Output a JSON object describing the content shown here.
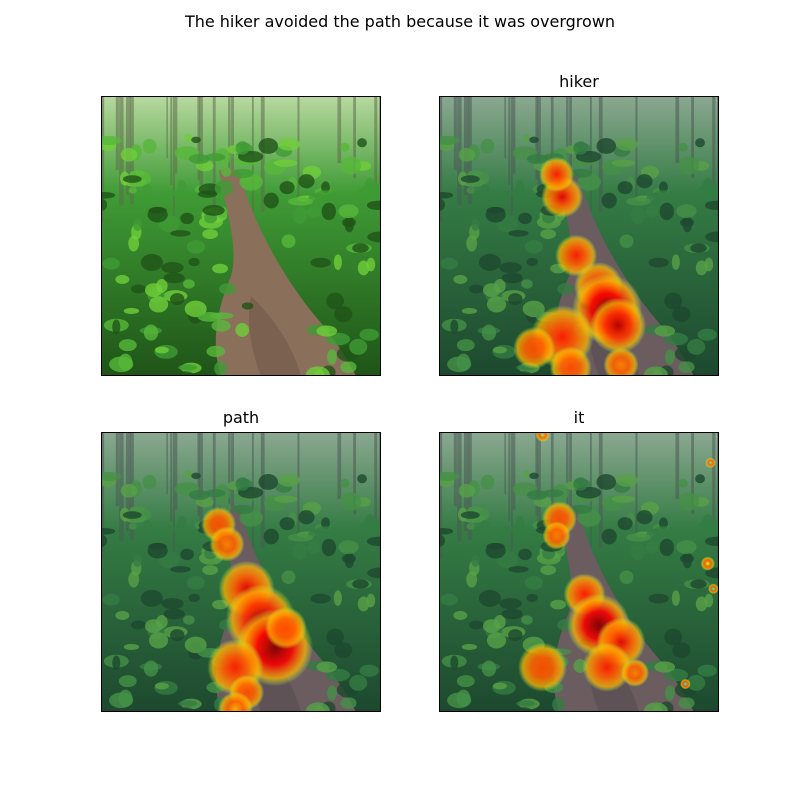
{
  "chart_data": {
    "type": "heatmap",
    "title": "The hiker avoided the path because it was overgrown",
    "panels": [
      {
        "id": "original",
        "title": "",
        "overlay": false,
        "hotspots": []
      },
      {
        "id": "hiker",
        "title": "hiker",
        "overlay": true,
        "hotspots": [
          {
            "cx": 0.44,
            "cy": 0.36,
            "r": 0.06,
            "v": 0.9
          },
          {
            "cx": 0.42,
            "cy": 0.28,
            "r": 0.05,
            "v": 0.85
          },
          {
            "cx": 0.49,
            "cy": 0.57,
            "r": 0.06,
            "v": 0.85
          },
          {
            "cx": 0.57,
            "cy": 0.68,
            "r": 0.07,
            "v": 0.9
          },
          {
            "cx": 0.6,
            "cy": 0.76,
            "r": 0.1,
            "v": 1.0
          },
          {
            "cx": 0.64,
            "cy": 0.82,
            "r": 0.08,
            "v": 0.95
          },
          {
            "cx": 0.44,
            "cy": 0.86,
            "r": 0.09,
            "v": 0.85
          },
          {
            "cx": 0.34,
            "cy": 0.9,
            "r": 0.06,
            "v": 0.8
          },
          {
            "cx": 0.47,
            "cy": 0.97,
            "r": 0.06,
            "v": 0.8
          },
          {
            "cx": 0.65,
            "cy": 0.96,
            "r": 0.05,
            "v": 0.75
          }
        ]
      },
      {
        "id": "path",
        "title": "path",
        "overlay": true,
        "hotspots": [
          {
            "cx": 0.42,
            "cy": 0.33,
            "r": 0.05,
            "v": 0.8
          },
          {
            "cx": 0.45,
            "cy": 0.4,
            "r": 0.05,
            "v": 0.75
          },
          {
            "cx": 0.52,
            "cy": 0.56,
            "r": 0.08,
            "v": 0.9
          },
          {
            "cx": 0.57,
            "cy": 0.67,
            "r": 0.1,
            "v": 0.95
          },
          {
            "cx": 0.62,
            "cy": 0.77,
            "r": 0.11,
            "v": 1.0
          },
          {
            "cx": 0.48,
            "cy": 0.84,
            "r": 0.08,
            "v": 0.85
          },
          {
            "cx": 0.66,
            "cy": 0.7,
            "r": 0.06,
            "v": 0.8
          },
          {
            "cx": 0.52,
            "cy": 0.93,
            "r": 0.05,
            "v": 0.8
          },
          {
            "cx": 0.48,
            "cy": 0.99,
            "r": 0.05,
            "v": 0.7
          }
        ]
      },
      {
        "id": "it",
        "title": "it",
        "overlay": true,
        "hotspots": [
          {
            "cx": 0.43,
            "cy": 0.31,
            "r": 0.05,
            "v": 0.8
          },
          {
            "cx": 0.42,
            "cy": 0.37,
            "r": 0.04,
            "v": 0.75
          },
          {
            "cx": 0.52,
            "cy": 0.58,
            "r": 0.06,
            "v": 0.85
          },
          {
            "cx": 0.57,
            "cy": 0.69,
            "r": 0.09,
            "v": 1.0
          },
          {
            "cx": 0.65,
            "cy": 0.75,
            "r": 0.07,
            "v": 0.9
          },
          {
            "cx": 0.6,
            "cy": 0.84,
            "r": 0.07,
            "v": 0.85
          },
          {
            "cx": 0.37,
            "cy": 0.84,
            "r": 0.07,
            "v": 0.8
          },
          {
            "cx": 0.7,
            "cy": 0.86,
            "r": 0.04,
            "v": 0.75
          },
          {
            "cx": 0.96,
            "cy": 0.47,
            "r": 0.02,
            "v": 0.6
          },
          {
            "cx": 0.97,
            "cy": 0.11,
            "r": 0.015,
            "v": 0.45
          },
          {
            "cx": 0.37,
            "cy": 0.01,
            "r": 0.02,
            "v": 0.5
          },
          {
            "cx": 0.98,
            "cy": 0.56,
            "r": 0.015,
            "v": 0.4
          },
          {
            "cx": 0.88,
            "cy": 0.9,
            "r": 0.015,
            "v": 0.4
          }
        ]
      }
    ],
    "colormap": "jet",
    "grid": false,
    "colors": {
      "path": "#8a6f5a",
      "path_dark": "#6b5344",
      "foliage": "#3f9b35",
      "foliage_dark": "#1f5418",
      "foliage_light": "#6fce3a",
      "canopy": "#b8d9a0",
      "overlay_tint": "#1a2a6b",
      "border": "#000000"
    }
  }
}
